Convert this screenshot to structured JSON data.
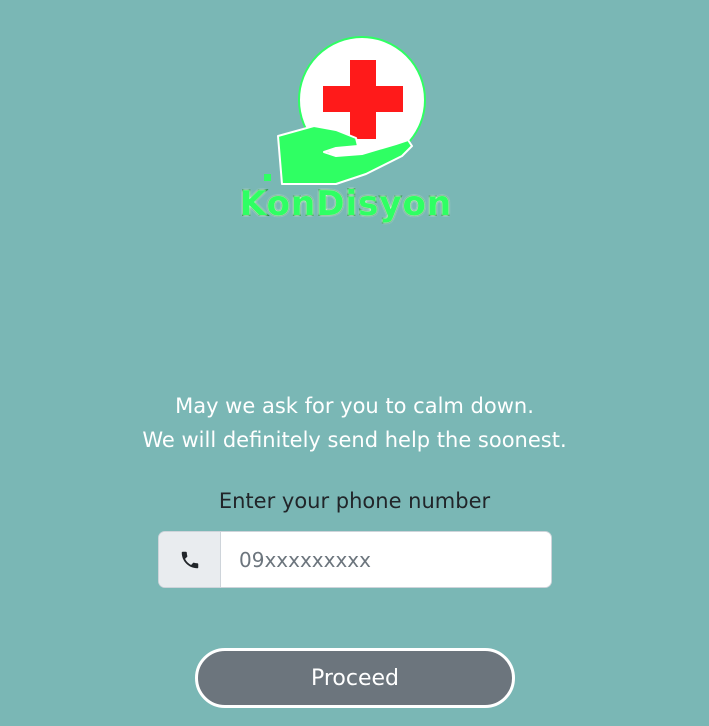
{
  "brand": {
    "name": "KonDisyon",
    "logo_icon": "medical-cross-hand-icon",
    "colors": {
      "green": "#2fff63",
      "red": "#ff1a1a"
    }
  },
  "message": {
    "line1": "May we ask for you to calm down.",
    "line2": "We will definitely send help the soonest."
  },
  "phone": {
    "label": "Enter your phone number",
    "placeholder": "09xxxxxxxxx",
    "icon": "phone-icon"
  },
  "actions": {
    "proceed_label": "Proceed"
  },
  "theme": {
    "background": "#7ab7b5",
    "button": "#6c757d"
  }
}
